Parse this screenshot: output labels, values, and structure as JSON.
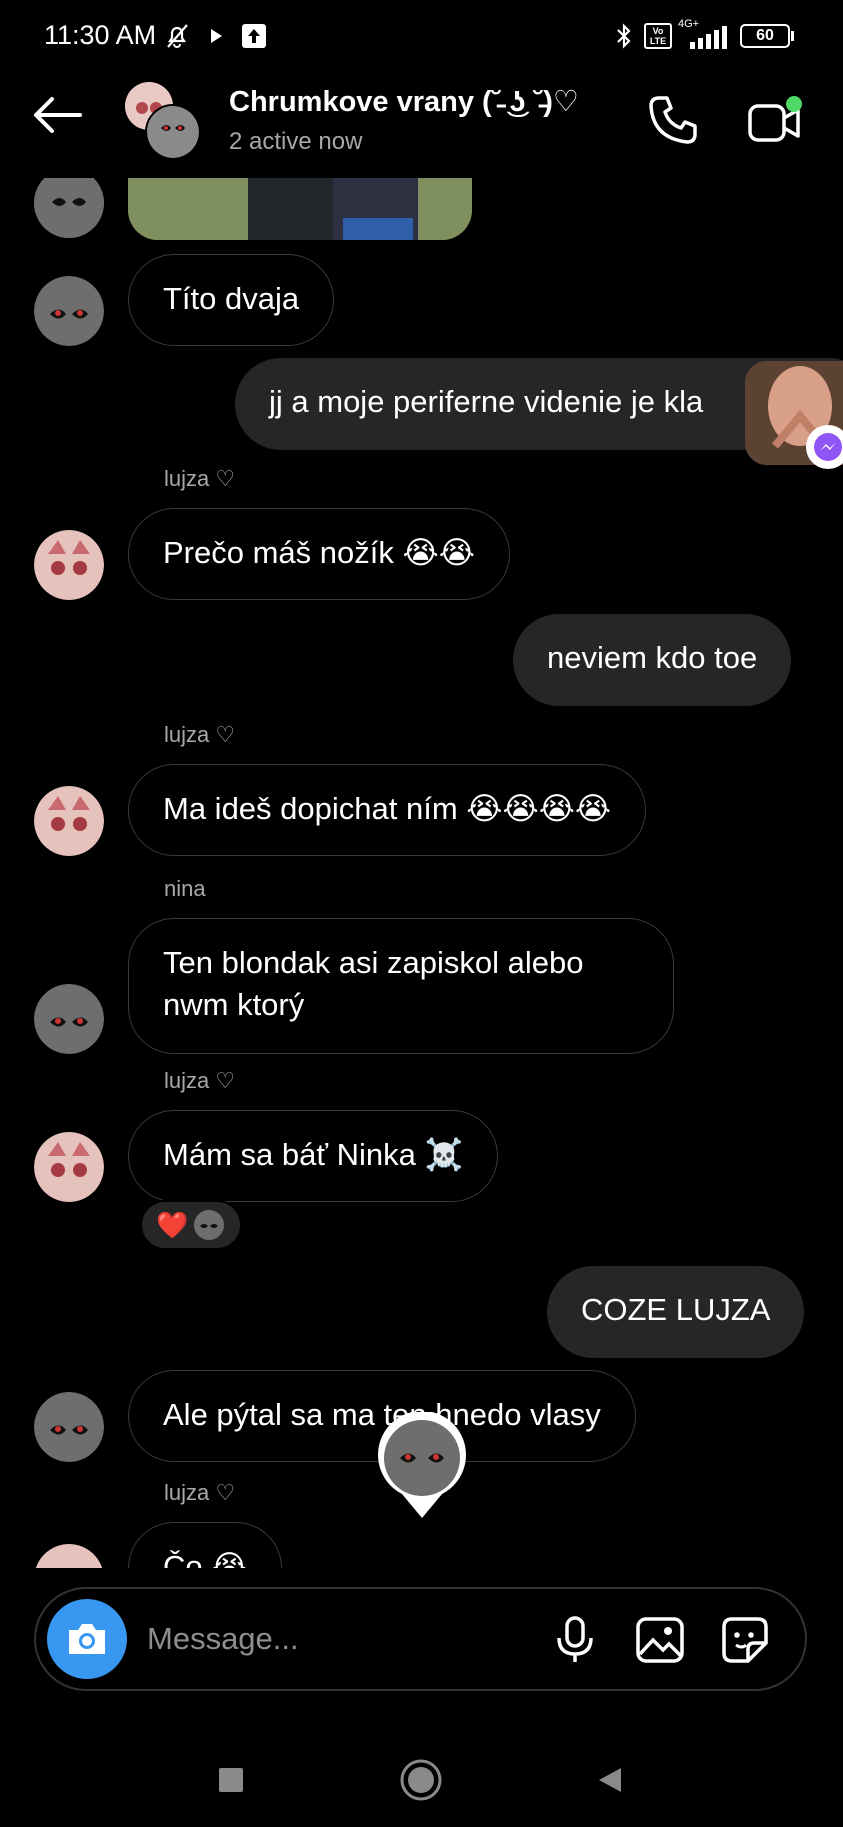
{
  "status": {
    "time": "11:30 AM",
    "volte": "Vo LTE",
    "network": "4G+",
    "battery": "60"
  },
  "header": {
    "title": "Chrumkove vrany (˘̵ ͜ʖ ˘̵)♡",
    "subtitle": "2 active now"
  },
  "messages": [
    {
      "text": "Títo dvaja"
    },
    {
      "text": "jj a moje periferne videnie je kla"
    },
    {
      "sender": "lujza ♡",
      "text": "Prečo máš nožík 😭😭"
    },
    {
      "text": "neviem kdo toe"
    },
    {
      "sender": "lujza ♡",
      "text": "Ma ideš dopichat ním 😭😭😭😭"
    },
    {
      "sender": "nina",
      "text": "Ten blondak asi zapiskol alebo nwm ktorý"
    },
    {
      "sender": "lujza ♡",
      "text": "Mám sa báť Ninka ☠️",
      "reaction": "❤️"
    },
    {
      "text": "COZE LUJZA"
    },
    {
      "text": "Ale pýtal sa ma ten hnedo vlasy"
    },
    {
      "sender": "lujza ♡",
      "text": "Čo 😭"
    }
  ],
  "composer": {
    "placeholder": "Message..."
  },
  "colors": {
    "accent": "#3897f0",
    "active": "#4cd964",
    "bubble_out": "#262626"
  }
}
